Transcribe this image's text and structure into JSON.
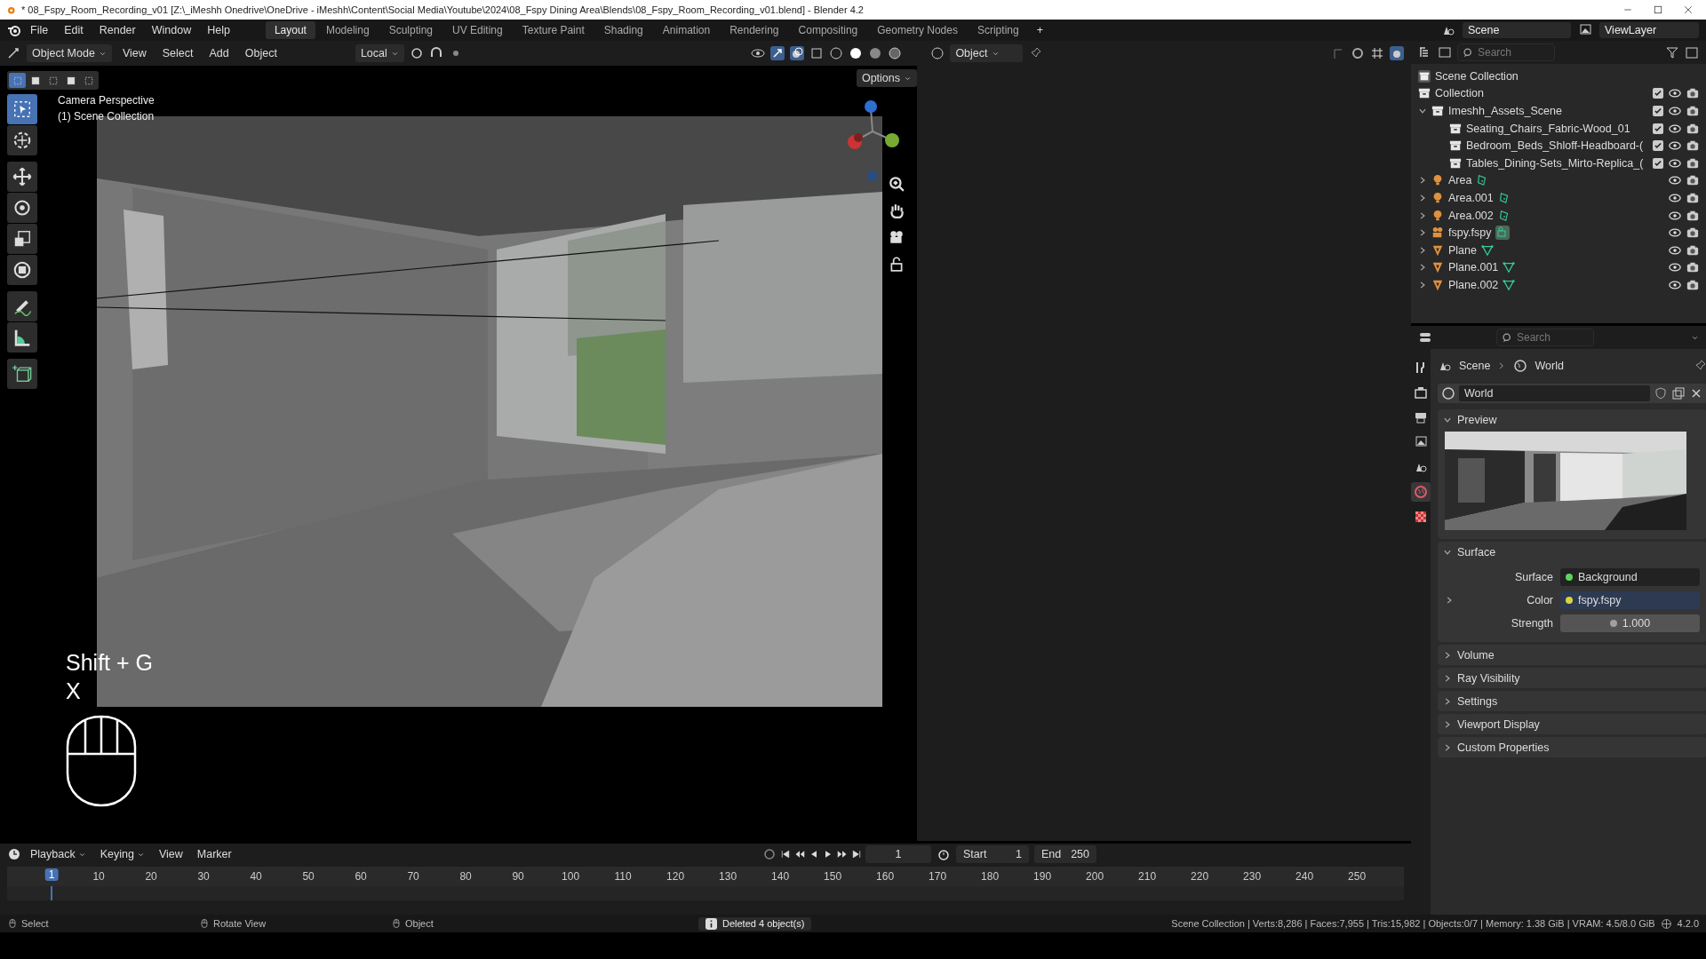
{
  "window": {
    "title": "* 08_Fspy_Room_Recording_v01 [Z:\\_iMeshh Onedrive\\OneDrive - iMeshh\\Content\\Social Media\\Youtube\\2024\\08_Fspy Dining Area\\Blends\\08_Fspy_Room_Recording_v01.blend] - Blender 4.2"
  },
  "menu": [
    "File",
    "Edit",
    "Render",
    "Window",
    "Help"
  ],
  "workspaces": [
    {
      "label": "Layout",
      "selected": true
    },
    {
      "label": "Modeling",
      "selected": false
    },
    {
      "label": "Sculpting",
      "selected": false
    },
    {
      "label": "UV Editing",
      "selected": false
    },
    {
      "label": "Texture Paint",
      "selected": false
    },
    {
      "label": "Shading",
      "selected": false
    },
    {
      "label": "Animation",
      "selected": false
    },
    {
      "label": "Rendering",
      "selected": false
    },
    {
      "label": "Compositing",
      "selected": false
    },
    {
      "label": "Geometry Nodes",
      "selected": false
    },
    {
      "label": "Scripting",
      "selected": false
    }
  ],
  "add_workspace": "+",
  "scene": "Scene",
  "view_layer": "ViewLayer",
  "viewport": {
    "mode": "Object Mode",
    "menus": [
      "View",
      "Select",
      "Add",
      "Object"
    ],
    "orientation": "Local",
    "snap_target": "Object",
    "options": "Options",
    "select_modes": [
      {
        "selected": true
      },
      {
        "selected": false
      },
      {
        "selected": false
      },
      {
        "selected": false
      },
      {
        "selected": false
      }
    ],
    "overlay": [
      "Camera Perspective",
      "(1) Scene Collection"
    ],
    "keys": [
      "Shift + G",
      "X"
    ],
    "tools": [
      {
        "kind": "select",
        "selected": true
      },
      {
        "kind": "cursor",
        "selected": false
      },
      {
        "kind": "move",
        "selected": false
      },
      {
        "kind": "rotate",
        "selected": false
      },
      {
        "kind": "scale",
        "selected": false
      },
      {
        "kind": "transform",
        "selected": false
      },
      {
        "kind": "annotate",
        "selected": false
      },
      {
        "kind": "measure",
        "selected": false
      },
      {
        "kind": "add",
        "selected": false
      }
    ]
  },
  "outliner": {
    "search": {
      "placeholder": "Search"
    },
    "tree": [
      {
        "name": "Scene Collection",
        "kind": "root",
        "children": [
          {
            "name": "Collection",
            "kind": "collection",
            "checked": true
          },
          {
            "name": "Imeshh_Assets_Scene",
            "kind": "collection",
            "checked": true,
            "expanded": true,
            "children": [
              {
                "name": "Seating_Chairs_Fabric-Wood_01",
                "kind": "collection",
                "checked": true
              },
              {
                "name": "Bedroom_Beds_Shloff-Headboard-(",
                "kind": "collection",
                "checked": true
              },
              {
                "name": "Tables_Dining-Sets_Mirto-Replica_(",
                "kind": "collection",
                "checked": true
              }
            ]
          },
          {
            "name": "Area",
            "kind": "light",
            "expanded": false
          },
          {
            "name": "Area.001",
            "kind": "light",
            "expanded": false
          },
          {
            "name": "Area.002",
            "kind": "light",
            "expanded": false
          },
          {
            "name": "fspy.fspy",
            "kind": "camera",
            "expanded": false
          },
          {
            "name": "Plane",
            "kind": "mesh",
            "expanded": false
          },
          {
            "name": "Plane.001",
            "kind": "mesh",
            "expanded": false
          },
          {
            "name": "Plane.002",
            "kind": "mesh",
            "expanded": false
          }
        ]
      }
    ]
  },
  "properties": {
    "search": {
      "placeholder": "Search"
    },
    "tabs": [
      {
        "kind": "tool",
        "selected": false
      },
      {
        "kind": "render",
        "selected": false
      },
      {
        "kind": "output",
        "selected": false
      },
      {
        "kind": "view_layer",
        "selected": false
      },
      {
        "kind": "scene",
        "selected": false
      },
      {
        "kind": "world",
        "selected": true
      },
      {
        "kind": "texture",
        "selected": false
      }
    ],
    "breadcrumb": [
      "Scene",
      "World"
    ],
    "datablock": "World",
    "panels": [
      {
        "title": "Preview",
        "kind": "preview",
        "expanded": true
      },
      {
        "title": "Surface",
        "kind": "surface",
        "expanded": true,
        "fields": [
          {
            "label": "Surface",
            "value": "Background",
            "color": "#5ed35e",
            "kind": "link"
          },
          {
            "label": "Color",
            "value": "fspy.fspy",
            "color": "#d6d63a",
            "kind": "link",
            "expandable": true
          },
          {
            "label": "Strength",
            "value": "1.000",
            "color": "#a0a0a0",
            "kind": "number"
          }
        ]
      },
      {
        "title": "Volume",
        "expanded": false
      },
      {
        "title": "Ray Visibility",
        "expanded": false
      },
      {
        "title": "Settings",
        "expanded": false
      },
      {
        "title": "Viewport Display",
        "expanded": false
      },
      {
        "title": "Custom Properties",
        "expanded": false
      }
    ]
  },
  "timeline": {
    "menus": [
      "Playback",
      "Keying",
      "View",
      "Marker"
    ],
    "current_frame": "1",
    "start_label": "Start",
    "start": "1",
    "end_label": "End",
    "end": "250",
    "ruler": [
      "1",
      "10",
      "20",
      "30",
      "40",
      "50",
      "60",
      "70",
      "80",
      "90",
      "100",
      "110",
      "120",
      "130",
      "140",
      "150",
      "160",
      "170",
      "180",
      "190",
      "200",
      "210",
      "220",
      "230",
      "240",
      "250"
    ]
  },
  "status_bar": {
    "hints": [
      "Select",
      "Rotate View",
      "Object"
    ],
    "message": "Deleted 4 object(s)",
    "stats": "Scene Collection | Verts:8,286 | Faces:7,955 | Tris:15,982 | Objects:0/7 | Memory: 1.38 GiB | VRAM: 4.5/8.0 GiB",
    "version": "4.2.0"
  }
}
